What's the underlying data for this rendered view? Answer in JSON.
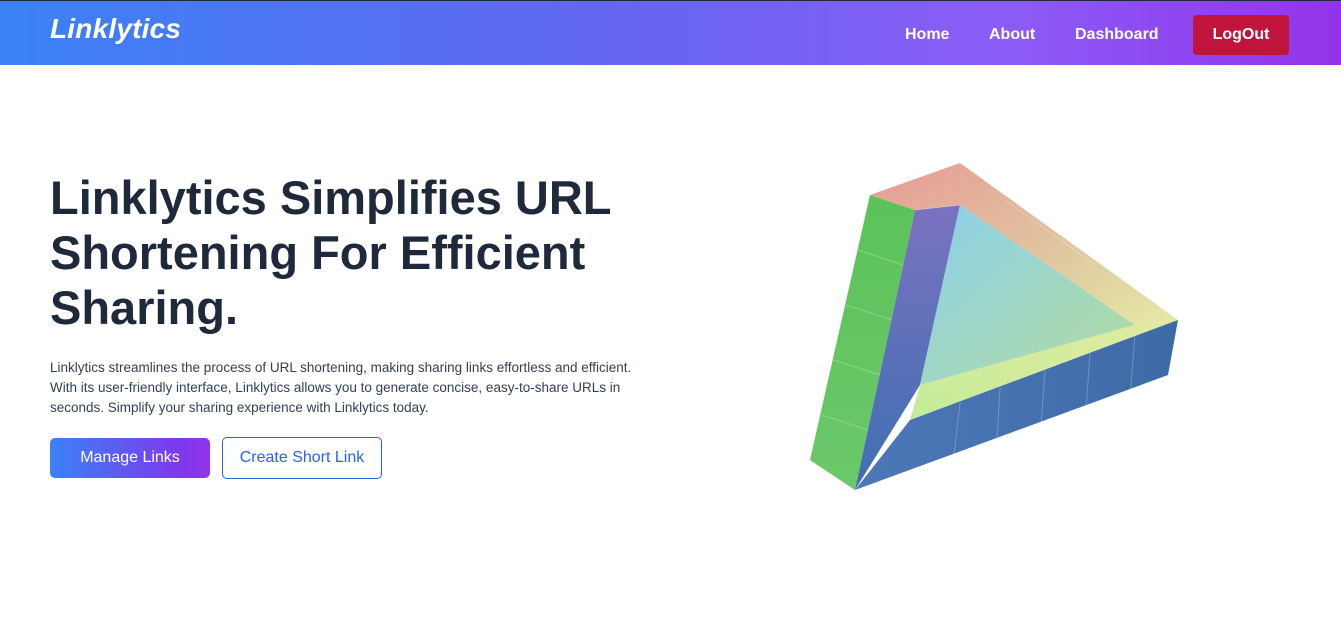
{
  "navbar": {
    "brand": "Linklytics",
    "links": {
      "home": "Home",
      "about": "About",
      "dashboard": "Dashboard"
    },
    "logout_label": "LogOut"
  },
  "hero": {
    "title": "Linklytics Simplifies URL Shortening For Efficient Sharing.",
    "description": "Linklytics streamlines the process of URL shortening, making sharing links effortless and efficient. With its user-friendly interface, Linklytics allows you to generate concise, easy-to-share URLs in seconds. Simplify your sharing experience with Linklytics today.",
    "primary_button": "Manage Links",
    "secondary_button": "Create Short Link"
  },
  "illustration": {
    "icon": "impossible-triangle-illustration"
  },
  "colors": {
    "nav_gradient_start": "#3b82f6",
    "nav_gradient_end": "#9333ea",
    "logout": "#c0143c",
    "title_text": "#1e293b",
    "outline_accent": "#2563eb"
  }
}
